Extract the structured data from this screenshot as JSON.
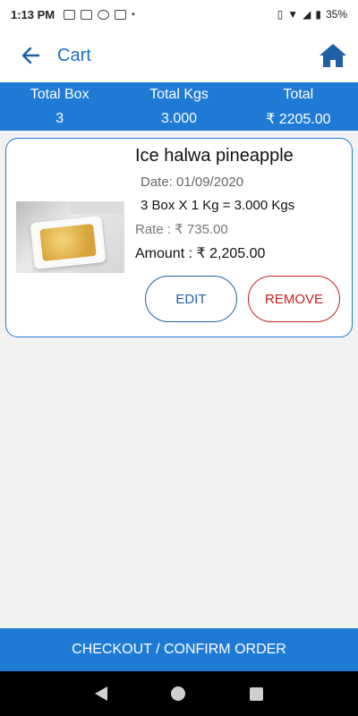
{
  "status": {
    "time": "1:13 PM",
    "battery": "35%"
  },
  "appbar": {
    "title": "Cart"
  },
  "summary": {
    "headers": [
      "Total Box",
      "Total Kgs",
      "Total"
    ],
    "values": [
      "3",
      "3.000",
      "₹ 2205.00"
    ]
  },
  "cart_items": [
    {
      "name": "Ice halwa pineapple",
      "date": "Date: 01/09/2020",
      "quantity": "3 Box X 1 Kg = 3.000 Kgs",
      "rate": "Rate : ₹ 735.00",
      "amount": "Amount : ₹ 2,205.00",
      "edit_label": "EDIT",
      "remove_label": "REMOVE"
    }
  ],
  "footer": {
    "checkout_label": "CHECKOUT / CONFIRM ORDER"
  },
  "colors": {
    "primary": "#1f7ad6",
    "title": "#1a6fc4",
    "remove": "#c62020"
  }
}
